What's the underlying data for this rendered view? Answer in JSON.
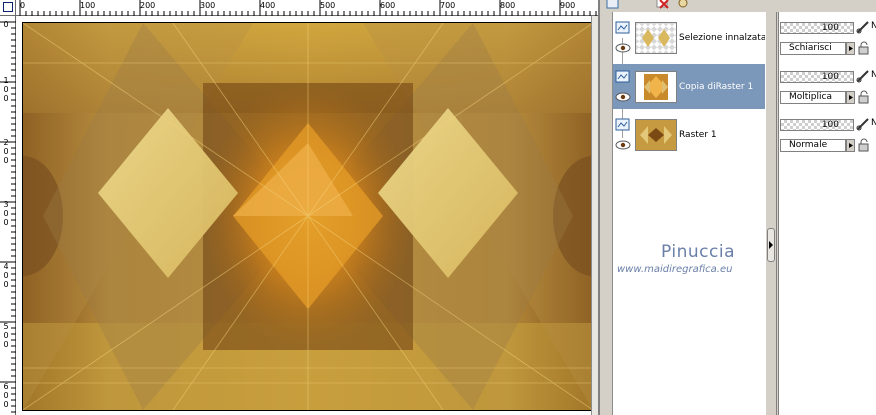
{
  "ruler": {
    "top_labels": [
      "0",
      "100",
      "200",
      "300",
      "400",
      "500",
      "600",
      "700",
      "800",
      "900"
    ],
    "left_labels": [
      "0",
      "1\n0\n0",
      "2\n0\n0",
      "3\n0\n0",
      "4\n0\n0",
      "5\n0\n0",
      "6\n0\n0"
    ]
  },
  "layers": [
    {
      "name": "Selezione innalzata",
      "selected": false,
      "thumb": "selection"
    },
    {
      "name": "Copia diRaster 1",
      "selected": true,
      "thumb": "copy"
    },
    {
      "name": "Raster 1",
      "selected": false,
      "thumb": "raster"
    }
  ],
  "properties": [
    {
      "opacity": "100",
      "blend": "Schiarisci",
      "n": "N"
    },
    {
      "opacity": "100",
      "blend": "Moltiplica",
      "n": "N"
    },
    {
      "opacity": "100",
      "blend": "Normale",
      "n": "N"
    }
  ],
  "watermark": {
    "title": "Pinuccia",
    "url": "www.maidiregrafica.eu"
  },
  "icons": {
    "new_layer": "new-layer-icon",
    "delete": "delete-layer-icon",
    "properties": "layer-properties-icon",
    "visibility": "eye-icon",
    "raster": "raster-layer-icon",
    "brush": "brush-icon",
    "lock": "lock-icon"
  },
  "colors": {
    "selected_row": "#7b97b9",
    "panel_bg": "#d4d0c8",
    "watermark": "#6a7fa8"
  }
}
